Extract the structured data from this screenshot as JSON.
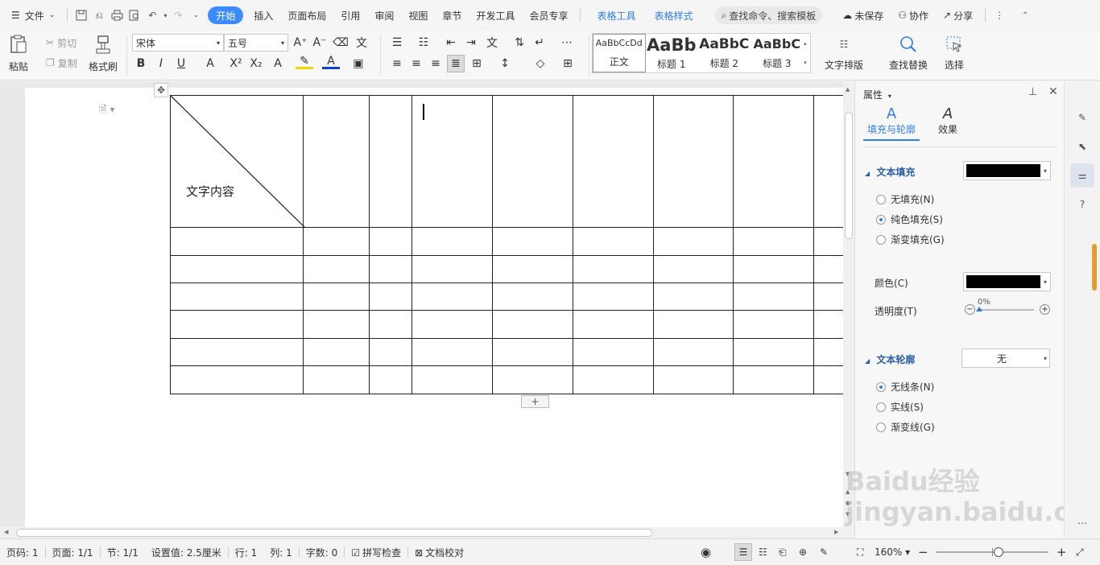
{
  "menubar": {
    "file": "文件",
    "tabs": [
      "开始",
      "插入",
      "页面布局",
      "引用",
      "审阅",
      "视图",
      "章节",
      "开发工具",
      "会员专享"
    ],
    "tool_tabs": [
      "表格工具",
      "表格样式"
    ],
    "search": "查找命令、搜索模板",
    "unsaved": "未保存",
    "collab": "协作",
    "share": "分享"
  },
  "ribbon": {
    "paste": "粘贴",
    "cut": "剪切",
    "copy": "复制",
    "format_painter": "格式刷",
    "font_name": "宋体",
    "font_size": "五号",
    "styles": [
      {
        "sample": "AaBbCcDd",
        "name": "正文"
      },
      {
        "sample": "AaBb",
        "name": "标题 1"
      },
      {
        "sample": "AaBbC",
        "name": "标题 2"
      },
      {
        "sample": "AaBbC",
        "name": "标题 3"
      }
    ],
    "text_layout": "文字排版",
    "find_replace": "查找替换",
    "select": "选择"
  },
  "document": {
    "diagonal_cell_text": "文字内容"
  },
  "panel": {
    "title": "属性",
    "tabs": [
      "填充与轮廓",
      "效果"
    ],
    "text_fill": "文本填充",
    "fill_options": [
      "无填充(N)",
      "纯色填充(S)",
      "渐变填充(G)"
    ],
    "color_label": "颜色(C)",
    "transparency_label": "透明度(T)",
    "transparency_value": "0%",
    "text_outline": "文本轮廓",
    "outline_value": "无",
    "outline_options": [
      "无线条(N)",
      "实线(S)",
      "渐变线(G)"
    ],
    "fill_color": "#000000"
  },
  "status": {
    "page_code": "页码: 1",
    "page": "页面: 1/1",
    "section": "节: 1/1",
    "setting": "设置值: 2.5厘米",
    "row": "行: 1",
    "col": "列: 1",
    "words": "字数: 0",
    "spell": "拼写检查",
    "doc_check": "文档校对",
    "zoom": "160%"
  },
  "watermark": "Baidu经验 jingyan.baidu.com"
}
